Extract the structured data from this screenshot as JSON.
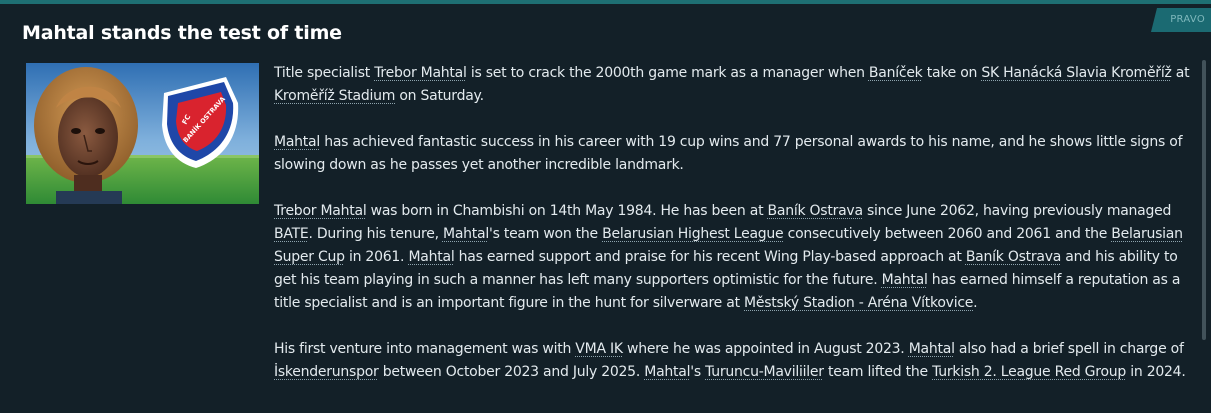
{
  "badge": "PRAVO",
  "headline": "Mahtal stands the test of time",
  "image": {
    "club_badge_text_top": "FC",
    "club_badge_text_main": "BANÍK OSTRAVA",
    "colors": {
      "sky": "#5a8ec4",
      "grass": "#3f9a3d",
      "badge_blue": "#1f47a8",
      "badge_red": "#d9232e"
    }
  },
  "article": {
    "p1": {
      "t1": "Title specialist ",
      "l1": "Trebor Mahtal",
      "t2": " is set to crack the 2000th game mark as a manager when ",
      "l2": "Baníček",
      "t3": " take on ",
      "l3": "SK Hanácká Slavia Kroměříž",
      "t4": " at ",
      "l4": "Kroměříž Stadium",
      "t5": " on Saturday."
    },
    "p2": {
      "l1": "Mahtal",
      "t1": " has achieved fantastic success in his career with 19 cup wins and 77 personal awards to his name, and he shows little signs of slowing down as he passes yet another incredible landmark."
    },
    "p3": {
      "l1": "Trebor Mahtal",
      "t1": " was born in Chambishi on 14th May 1984. He has been at ",
      "l2": "Baník Ostrava",
      "t2": " since June 2062, having previously managed ",
      "l3": "BATE",
      "t3": ". During his tenure, ",
      "l4": "Mahtal",
      "t4": "'s team won the ",
      "l5": "Belarusian Highest League",
      "t5": " consecutively between 2060 and 2061 and the ",
      "l6": "Belarusian Super Cup",
      "t6": " in 2061. ",
      "l7": "Mahtal",
      "t7": " has earned support and praise for his recent Wing Play-based approach at ",
      "l8": "Baník Ostrava",
      "t8": " and his ability to get his team playing in such a manner has left many supporters optimistic for the future. ",
      "l9": "Mahtal",
      "t9": " has earned himself a reputation as a title specialist and is an important figure in the hunt for silverware at ",
      "l10": "Městský Stadion - Aréna Vítkovice",
      "t10": "."
    },
    "p4": {
      "t1": "His first venture into management was with ",
      "l1": "VMA IK",
      "t2": " where he was appointed in August 2023. ",
      "l2": "Mahtal",
      "t3": " also had a brief spell in charge of ",
      "l3": "İskenderunspor",
      "t4": " between October 2023 and July 2025. ",
      "l4": "Mahtal",
      "t5": "'s ",
      "l5": "Turuncu-Maviliiler",
      "t6": " team lifted the ",
      "l6": "Turkish 2. League Red Group",
      "t7": " in 2024."
    }
  }
}
